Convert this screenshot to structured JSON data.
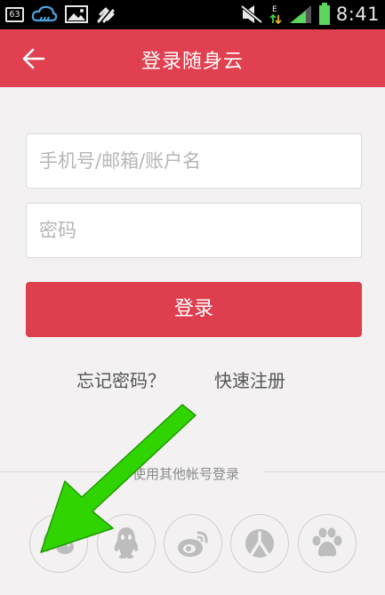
{
  "status_bar": {
    "notification_count": "63",
    "time": "8:41",
    "icons": [
      "notification-badge-icon",
      "cloud-icon",
      "image-icon",
      "usb-icon",
      "mute-icon",
      "data-transfer-icon",
      "signal-icon",
      "battery-icon"
    ]
  },
  "header": {
    "title": "登录随身云",
    "back_icon": "back-arrow-icon",
    "background": "#e0404f"
  },
  "form": {
    "username_placeholder": "手机号/邮箱/账户名",
    "password_placeholder": "密码",
    "login_label": "登录",
    "forgot_label": "忘记密码？",
    "register_label": "快速注册",
    "button_color": "#dd3f4e"
  },
  "other_login": {
    "label": "使用其他帐号登录",
    "providers": [
      "wechat-icon",
      "qq-icon",
      "weibo-icon",
      "renren-icon",
      "baidu-icon"
    ]
  },
  "annotation": {
    "type": "green-arrow",
    "color": "#2fd400",
    "points_to": "wechat-login-button"
  }
}
